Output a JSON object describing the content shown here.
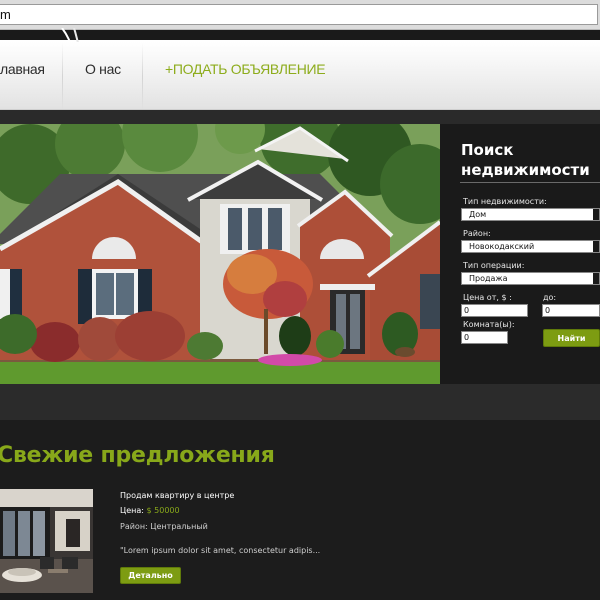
{
  "browser": {
    "address_value": "m"
  },
  "nav": {
    "items": [
      {
        "label": "лавная"
      },
      {
        "label": "О нас"
      },
      {
        "label": "+ПОДАТЬ ОБЪЯВЛЕНИЕ"
      }
    ]
  },
  "search": {
    "title_line1": "Поиск",
    "title_line2": "недвижимости",
    "property_type_label": "Тип недвижимости:",
    "property_type_value": "Дом",
    "district_label": "Район:",
    "district_value": "Новокодакский",
    "operation_label": "Тип операции:",
    "operation_value": "Продажа",
    "price_from_label": "Цена от, $ :",
    "price_to_label": "до:",
    "price_from_value": "0",
    "price_to_value": "0",
    "rooms_label": "Комната(ы):",
    "rooms_value": "0",
    "find_label": "Найти"
  },
  "offers": {
    "title": "Свежие предложения",
    "listing": {
      "title": "Продам квартиру в центре",
      "price_label": "Цена:",
      "price_value": "$ 50000",
      "district": "Район: Центральный",
      "excerpt": "\"Lorem ipsum dolor sit amet, consectetur adipis...",
      "detail_label": "Детально"
    }
  },
  "colors": {
    "accent": "#88a81a",
    "button": "#7d9c12",
    "panel_bg": "#1a1a1a",
    "page_bg": "#1c1c1c"
  }
}
